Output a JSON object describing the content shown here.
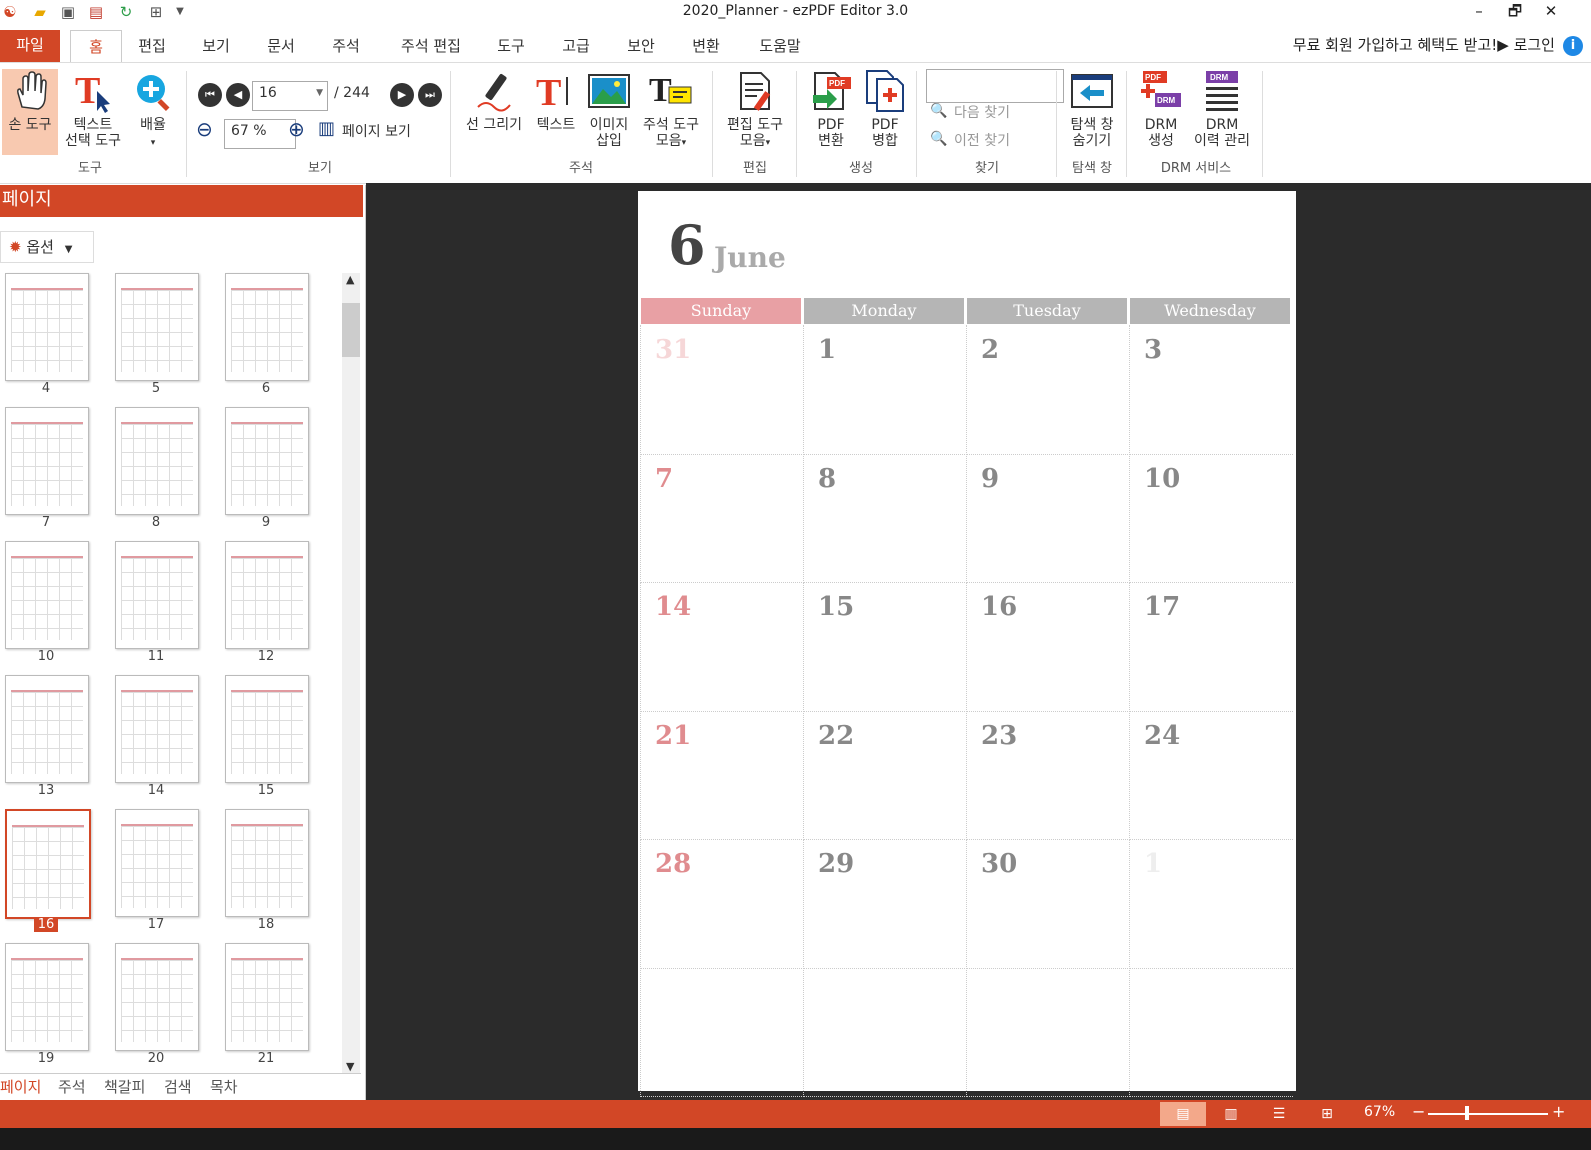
{
  "window": {
    "title": "2020_Planner - ezPDF Editor 3.0",
    "controls": [
      "–",
      "🗗",
      "✕"
    ]
  },
  "menu": {
    "file": "파일",
    "tabs": [
      "홈",
      "편집",
      "보기",
      "문서",
      "주석",
      "주석 편집",
      "도구",
      "고급",
      "보안",
      "변환",
      "도움말"
    ],
    "promo": "무료 회원 가입하고 혜택도 받고!▶ 로그인",
    "info": "i"
  },
  "ribbon": {
    "hand": "손 도구",
    "text_select_1": "텍스트",
    "text_select_2": "선택 도구",
    "zoom": "배율",
    "zoom_arrow": "▾",
    "group_tools": "도구",
    "page_current": "16",
    "page_total": "/ 244",
    "zoom_value": "67 %",
    "page_view": "페이지 보기",
    "group_view": "보기",
    "draw_line": "선 그리기",
    "text": "텍스트",
    "image_1": "이미지",
    "image_2": "삽입",
    "annot_tools_1": "주석 도구",
    "annot_tools_2": "모음",
    "group_annot": "주석",
    "edit_tools_1": "편집 도구",
    "edit_tools_2": "모음",
    "group_edit": "편집",
    "pdf_convert_1": "PDF",
    "pdf_convert_2": "변환",
    "pdf_merge_1": "PDF",
    "pdf_merge_2": "병합",
    "group_create": "생성",
    "find_next": "다음 찾기",
    "find_prev": "이전 찾기",
    "group_find": "찾기",
    "hide_nav_1": "탐색 창",
    "hide_nav_2": "숨기기",
    "group_nav": "탐색 창",
    "drm_create_1": "DRM",
    "drm_create_2": "생성",
    "drm_history_1": "DRM",
    "drm_history_2": "이력 관리",
    "group_drm": "DRM 서비스"
  },
  "panel": {
    "title": "페이지",
    "options": "옵션",
    "thumbnails": [
      "4",
      "5",
      "6",
      "7",
      "8",
      "9",
      "10",
      "11",
      "12",
      "13",
      "14",
      "15",
      "16",
      "17",
      "18",
      "19",
      "20",
      "21"
    ],
    "selected": "16",
    "bottom_tabs": [
      "페이지",
      "주석",
      "책갈피",
      "검색",
      "목차"
    ]
  },
  "calendar": {
    "month_number": "6",
    "month_name": "June",
    "days": [
      "Sunday",
      "Monday",
      "Tuesday",
      "Wednesday"
    ],
    "header_colors": [
      "#e8a0a4",
      "#b5b5b5",
      "#b5b5b5",
      "#b5b5b5"
    ],
    "weeks": [
      [
        "31",
        "1",
        "2",
        "3"
      ],
      [
        "7",
        "8",
        "9",
        "10"
      ],
      [
        "14",
        "15",
        "16",
        "17"
      ],
      [
        "21",
        "22",
        "23",
        "24"
      ],
      [
        "28",
        "29",
        "30",
        "1"
      ],
      [
        "",
        "",
        "",
        ""
      ]
    ]
  },
  "status": {
    "zoom": "67%",
    "minus": "−",
    "plus": "+"
  }
}
